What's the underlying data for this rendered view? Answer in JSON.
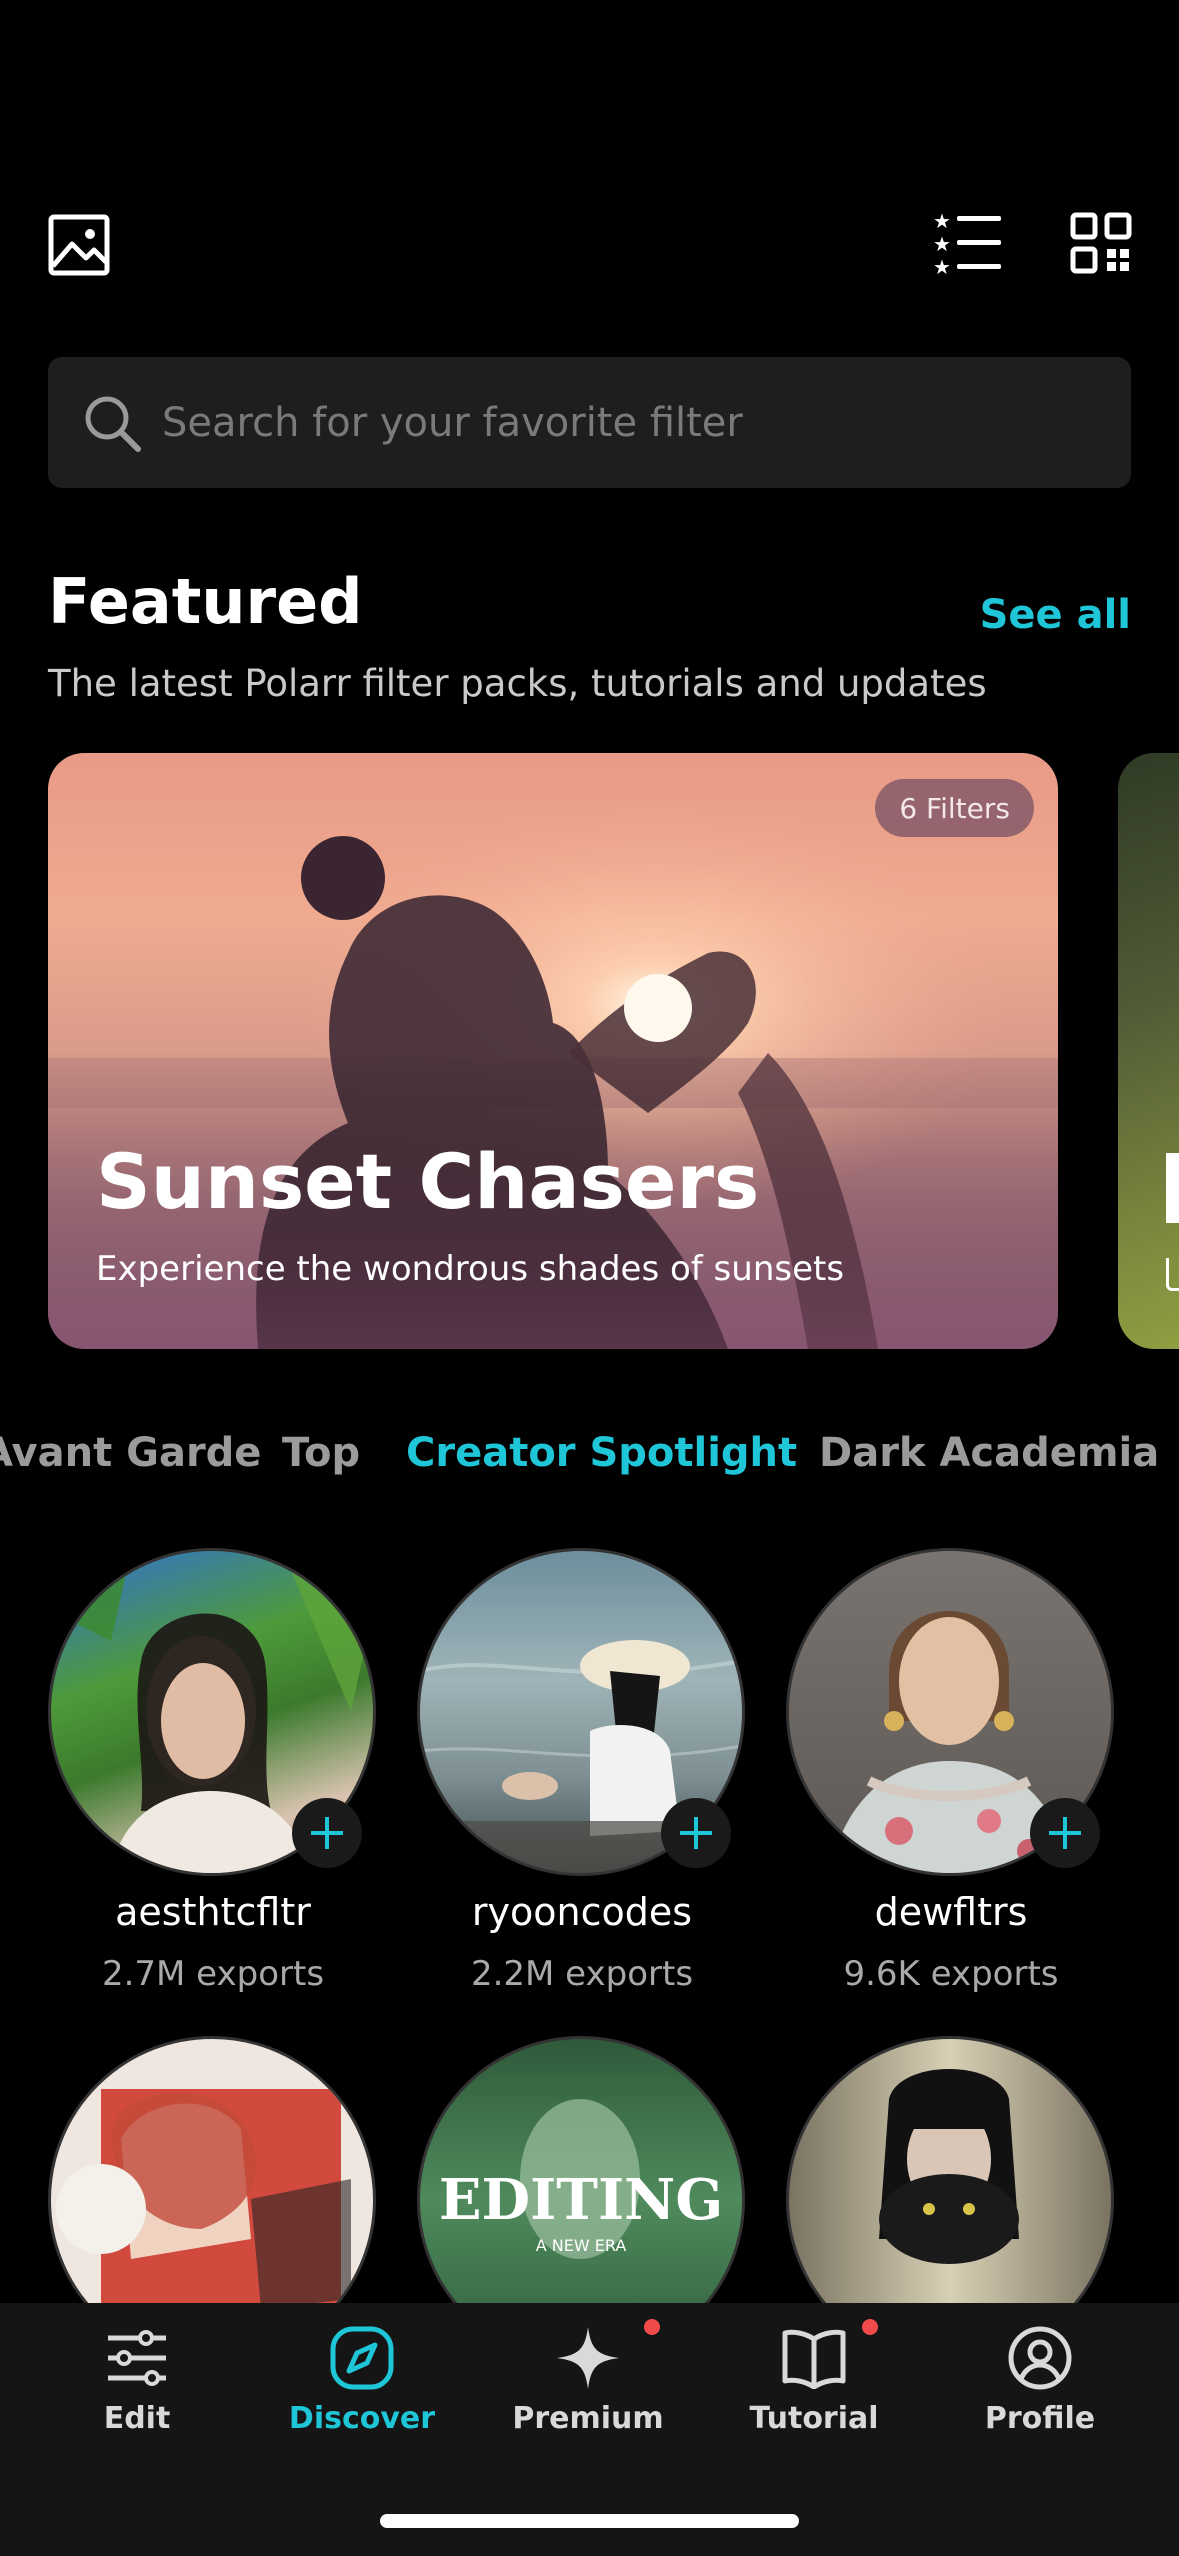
{
  "search": {
    "placeholder": "Search for your favorite filter"
  },
  "featured": {
    "title": "Featured",
    "see_all": "See all",
    "subtitle": "The latest Polarr filter packs, tutorials and updates",
    "cards": [
      {
        "badge": "6 Filters",
        "title": "Sunset Chasers",
        "subtitle": "Experience the wondrous shades of sunsets"
      }
    ]
  },
  "tabs": [
    {
      "label": "Avant Garde",
      "active": false
    },
    {
      "label": "Top",
      "active": false
    },
    {
      "label": "Creator Spotlight",
      "active": true
    },
    {
      "label": "Dark Academia",
      "active": false
    }
  ],
  "creators": [
    {
      "name": "aesthtcfltr",
      "exports": "2.7M exports"
    },
    {
      "name": "ryooncodes",
      "exports": "2.2M exports"
    },
    {
      "name": "dewfltrs",
      "exports": "9.6K exports"
    },
    {
      "overlay_text": "EDITING",
      "overlay_sub": "A NEW ERA"
    }
  ],
  "nav": [
    {
      "label": "Edit",
      "icon": "sliders-icon",
      "active": false
    },
    {
      "label": "Discover",
      "icon": "compass-icon",
      "active": true
    },
    {
      "label": "Premium",
      "icon": "sparkle-icon",
      "active": false,
      "dot": true
    },
    {
      "label": "Tutorial",
      "icon": "book-icon",
      "active": false,
      "dot": true
    },
    {
      "label": "Profile",
      "icon": "profile-icon",
      "active": false
    }
  ],
  "colors": {
    "accent": "#1ec6d7",
    "background": "#000000",
    "notification": "#f04a4a"
  }
}
